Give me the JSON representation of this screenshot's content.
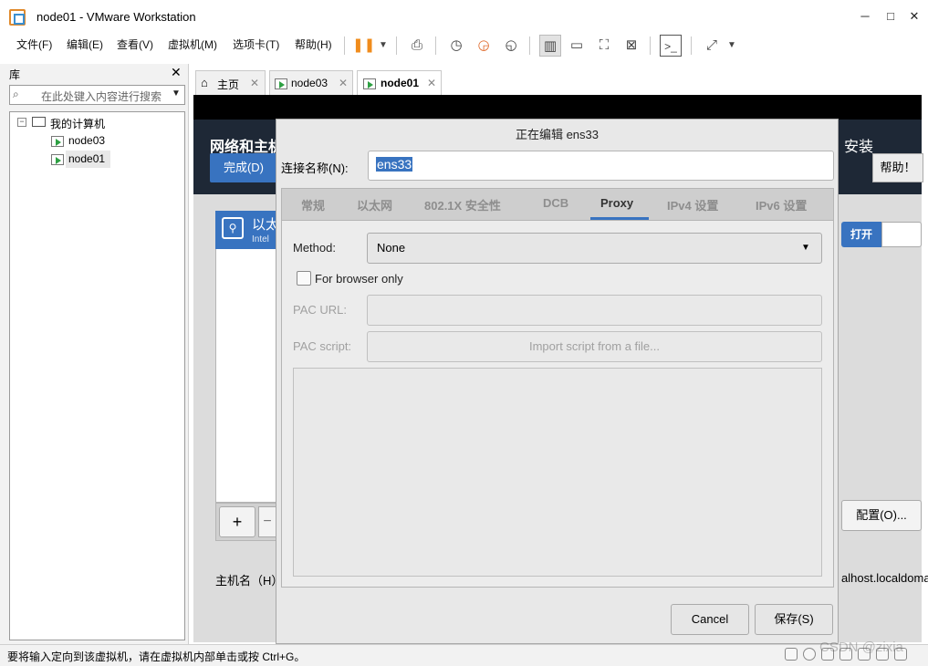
{
  "window": {
    "title": "node01 - VMware Workstation",
    "minimize": "─",
    "maximize": "□",
    "close": "✕"
  },
  "menu": [
    "文件(F)",
    "编辑(E)",
    "查看(V)",
    "虚拟机(M)",
    "选项卡(T)",
    "帮助(H)"
  ],
  "library": {
    "title": "库",
    "close": "✕",
    "search_placeholder": "在此处键入内容进行搜索",
    "root": "我的计算机",
    "vms": [
      "node03",
      "node01"
    ]
  },
  "tabs": [
    {
      "label": "主页"
    },
    {
      "label": "node03"
    },
    {
      "label": "node01"
    }
  ],
  "anaconda": {
    "title": "网络和主机",
    "right_title": "安装",
    "done": "完成(D)",
    "help": "帮助！",
    "iface_name": "以太",
    "iface_sub": "Intel",
    "switch_on": "打开",
    "configure": "配置(O)...",
    "hostname_label": "主机名（H）",
    "hostname_tail": "alhost.localdoma",
    "add": "+",
    "remove": "−"
  },
  "dialog": {
    "title": "正在编辑 ens33",
    "conn_label": "连接名称(N):",
    "conn_value": "ens33",
    "tabs": [
      "常规",
      "以太网",
      "802.1X 安全性",
      "DCB",
      "Proxy",
      "IPv4 设置",
      "IPv6 设置"
    ],
    "active_tab": "Proxy",
    "method_label": "Method:",
    "method_value": "None",
    "browser_only": "For browser only",
    "browser_only_checked": false,
    "pac_url_label": "PAC URL:",
    "pac_script_label": "PAC script:",
    "import_script": "Import script from a file...",
    "cancel": "Cancel",
    "save": "保存(S)"
  },
  "status": {
    "text": "要将输入定向到该虚拟机，请在虚拟机内部单击或按 Ctrl+G。",
    "watermark": "CSDN @zixia"
  }
}
